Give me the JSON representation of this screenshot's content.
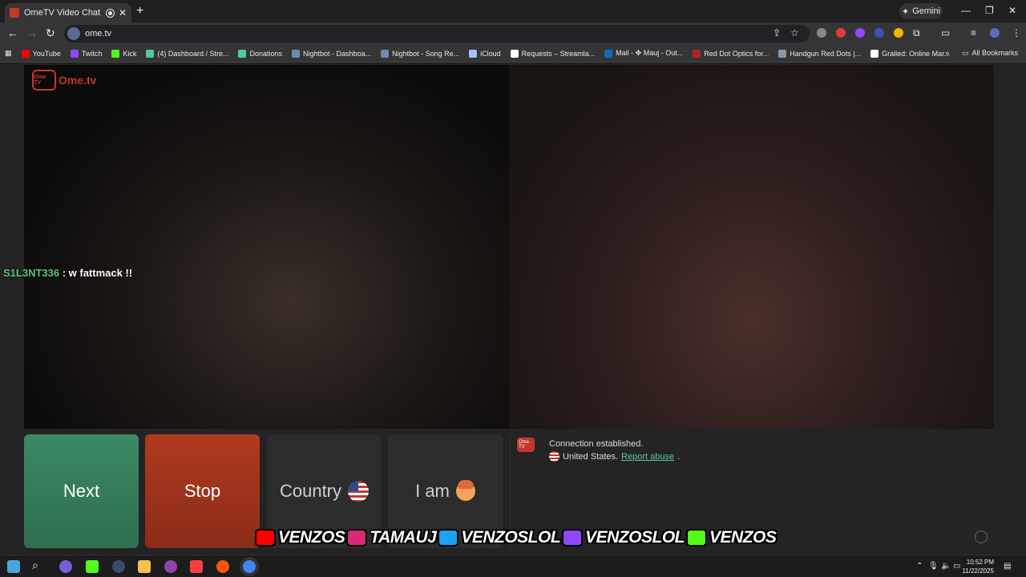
{
  "browser": {
    "tab_title": "OmeTV Video Chat — Ome",
    "new_tab_symbol": "+",
    "gemini_label": "Gemini",
    "url": "ome.tv",
    "all_bookmarks_label": "All Bookmarks",
    "bookmarks": [
      {
        "label": "YouTube",
        "color": "#ff0000"
      },
      {
        "label": "Twitch",
        "color": "#9146ff"
      },
      {
        "label": "Kick",
        "color": "#53fc18"
      },
      {
        "label": "(4) Dashboard / Stre...",
        "color": "#4ec9a0"
      },
      {
        "label": "Donations",
        "color": "#4ec9a0"
      },
      {
        "label": "Nightbot - Dashboa...",
        "color": "#6b8cae"
      },
      {
        "label": "Nightbot - Song Re...",
        "color": "#6b8cae"
      },
      {
        "label": "iCloud",
        "color": "#9fc3ff"
      },
      {
        "label": "Requests – Streamla...",
        "color": "#ffffff"
      },
      {
        "label": "Mail - ✥ Mauj - Out...",
        "color": "#0f6cbd"
      },
      {
        "label": "Red Dot Optics for...",
        "color": "#b22222"
      },
      {
        "label": "Handgun Red Dots |...",
        "color": "#8899aa"
      },
      {
        "label": "Grailed: Online Mar...",
        "color": "#ffffff"
      }
    ]
  },
  "ometv": {
    "logo_text": "Ome.tv",
    "logo_box_text": "Ome TV",
    "chat_overlay": {
      "user": "S1L3NT336",
      "message": " : w fattmack !!"
    },
    "buttons": {
      "next": "Next",
      "stop": "Stop",
      "country": "Country",
      "iam": "I am"
    },
    "chat": {
      "connection": "Connection established.",
      "country": "United States.",
      "report": "Report abuse",
      "report_suffix": "."
    }
  },
  "stream_banner": [
    {
      "text": "VENZOS",
      "icon": "youtube-icon",
      "color": "#ff0000"
    },
    {
      "text": "TAMAUJ",
      "icon": "instagram-icon",
      "color": "#d62976"
    },
    {
      "text": "VENZOSLOL",
      "icon": "twitter-icon",
      "color": "#1da1f2"
    },
    {
      "text": "VENZOSLOL",
      "icon": "twitch-icon",
      "color": "#9146ff"
    },
    {
      "text": "VENZOS",
      "icon": "kick-icon",
      "color": "#53fc18"
    }
  ],
  "taskbar": {
    "time": "10:52 PM",
    "date": "11/22/2025"
  }
}
